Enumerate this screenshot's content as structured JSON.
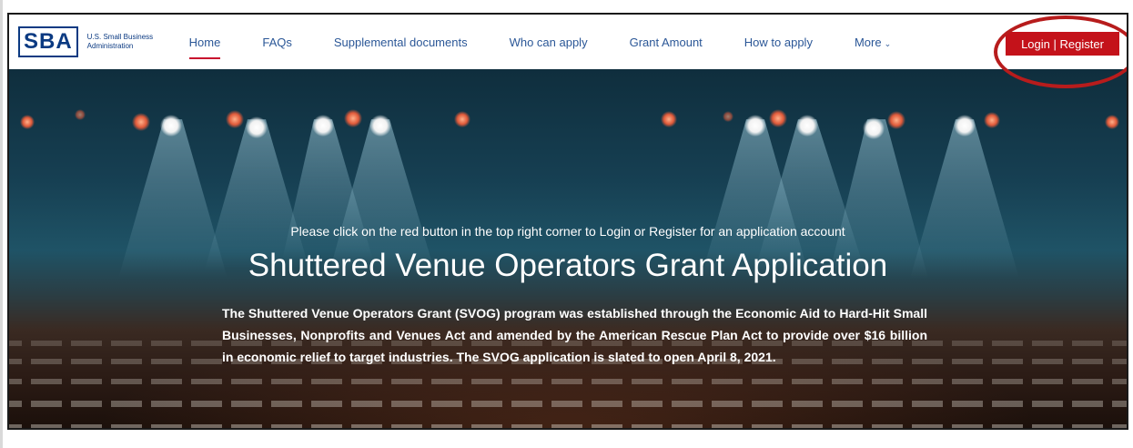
{
  "logo": {
    "mark": "SBA",
    "line1": "U.S. Small Business",
    "line2": "Administration"
  },
  "nav": {
    "items": [
      {
        "label": "Home",
        "active": true
      },
      {
        "label": "FAQs"
      },
      {
        "label": "Supplemental documents"
      },
      {
        "label": "Who can apply"
      },
      {
        "label": "Grant Amount"
      },
      {
        "label": "How to apply"
      },
      {
        "label": "More"
      }
    ],
    "more_icon": "chevron-down-icon"
  },
  "login_button": "Login | Register",
  "hero": {
    "instruction": "Please click on the red button in the top right corner to Login or Register for an application account",
    "title": "Shuttered Venue Operators Grant Application",
    "description": "The Shuttered Venue Operators Grant (SVOG) program was established through the Economic Aid to Hard-Hit Small Businesses, Nonprofits and Venues Act and amended by the American Rescue Plan Act to provide over $16 billion in economic relief to target industries. The SVOG application is slated to open April 8, 2021."
  },
  "colors": {
    "brand_blue": "#0b3a82",
    "nav_link": "#2b5797",
    "active_underline": "#c8102e",
    "login_red": "#c4121a",
    "annotation_ring": "#b71c1c"
  }
}
